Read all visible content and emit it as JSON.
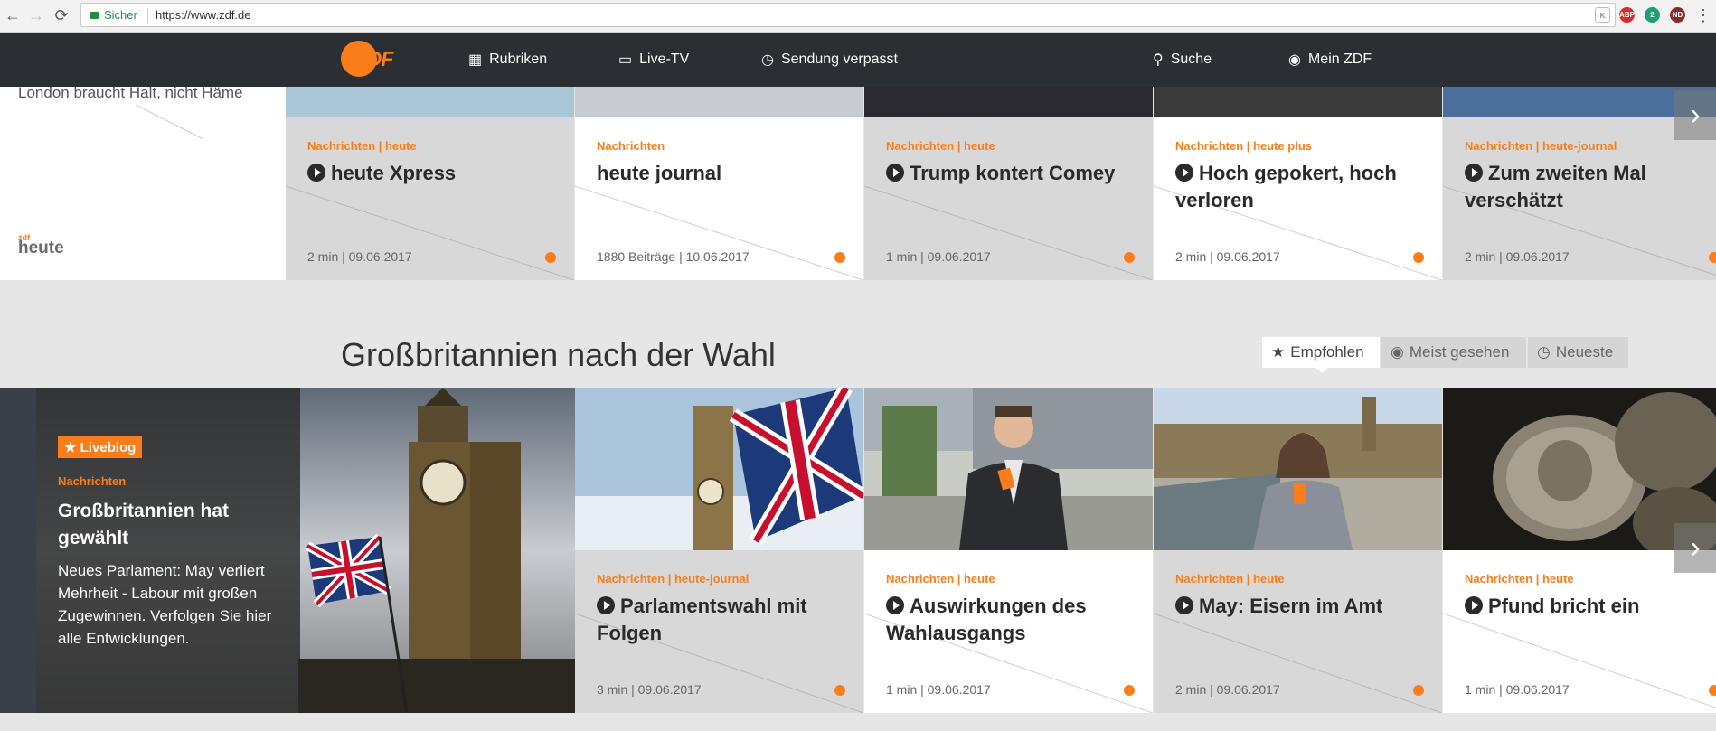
{
  "browser": {
    "secure_label": "Sicher",
    "url": "https://www.zdf.de",
    "extensions": [
      "K",
      "ABP",
      "2",
      "ND"
    ]
  },
  "header": {
    "logo_left": "2",
    "logo_right": "DF",
    "nav": [
      {
        "label": "Rubriken",
        "icon": "grid-icon"
      },
      {
        "label": "Live-TV",
        "icon": "tv-icon"
      },
      {
        "label": "Sendung verpasst",
        "icon": "clock-icon"
      },
      {
        "label": "Suche",
        "icon": "search-icon"
      },
      {
        "label": "Mein ZDF",
        "icon": "user-icon"
      }
    ]
  },
  "row1": {
    "left_teaser_title": "London braucht Halt, nicht Häme",
    "left_logo": "heute",
    "cards": [
      {
        "category": "Nachrichten | heute",
        "title": "heute Xpress",
        "video": true,
        "meta": "2 min | 09.06.2017",
        "bg": "#d8d8d8",
        "strip": "#a9c7d6"
      },
      {
        "category": "Nachrichten",
        "title": "heute journal",
        "video": false,
        "meta": "1880 Beiträge | 10.06.2017",
        "bg": "#ffffff",
        "strip": "#c8ccd0"
      },
      {
        "category": "Nachrichten | heute",
        "title": "Trump kontert Comey",
        "video": true,
        "meta": "1 min | 09.06.2017",
        "bg": "#d8d8d8",
        "strip": "#2a2a30"
      },
      {
        "category": "Nachrichten | heute plus",
        "title": "Hoch gepokert, hoch verloren",
        "video": true,
        "meta": "2 min | 09.06.2017",
        "bg": "#ffffff",
        "strip": "#3a3a3a"
      },
      {
        "category": "Nachrichten | heute-journal",
        "title": "Zum zweiten Mal verschätzt",
        "video": true,
        "meta": "2 min | 09.06.2017",
        "bg": "#d8d8d8",
        "strip": "#4a6f9a"
      }
    ]
  },
  "section": {
    "title": "Großbritannien nach der Wahl",
    "filters": [
      {
        "label": "Empfohlen",
        "icon": "star-icon",
        "active": true
      },
      {
        "label": "Meist gesehen",
        "icon": "eye-icon",
        "active": false
      },
      {
        "label": "Neueste",
        "icon": "clock-icon",
        "active": false
      }
    ]
  },
  "row2": {
    "big": {
      "badge": "Liveblog",
      "category": "Nachrichten",
      "title": "Großbritannien hat gewählt",
      "description": "Neues Parlament: May verliert Mehrheit - Labour mit großen Zugewinnen. Verfolgen Sie hier alle Entwicklungen."
    },
    "cards": [
      {
        "category": "Nachrichten | heute-journal",
        "title": "Parlamentswahl mit Folgen",
        "meta": "3 min | 09.06.2017",
        "bg": "#d8d8d8",
        "photo": "flag"
      },
      {
        "category": "Nachrichten | heute",
        "title": "Auswirkungen des Wahlausgangs",
        "meta": "1 min | 09.06.2017",
        "bg": "#ffffff",
        "photo": "reporter-man"
      },
      {
        "category": "Nachrichten | heute",
        "title": "May: Eisern im Amt",
        "meta": "2 min | 09.06.2017",
        "bg": "#d8d8d8",
        "photo": "reporter-woman"
      },
      {
        "category": "Nachrichten | heute",
        "title": "Pfund bricht ein",
        "meta": "1 min | 09.06.2017",
        "bg": "#ffffff",
        "photo": "coins"
      }
    ]
  },
  "colors": {
    "accent": "#fa7d19",
    "header": "#2b2f33"
  }
}
